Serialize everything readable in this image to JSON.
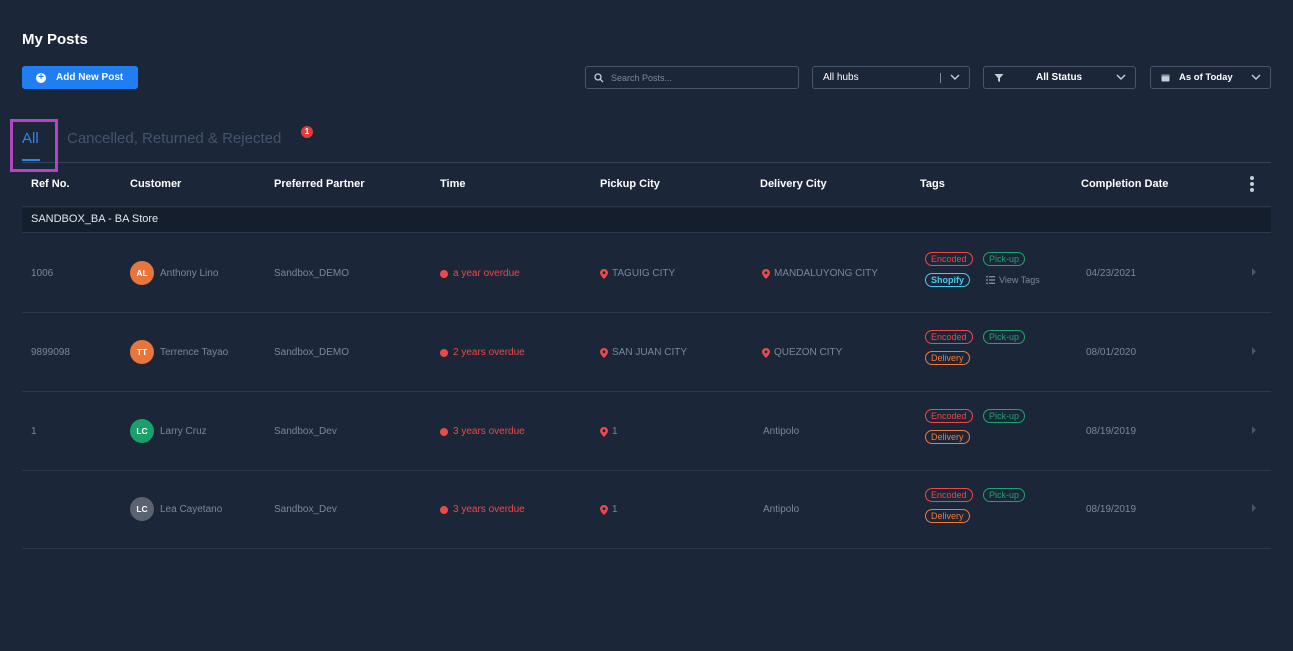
{
  "page": {
    "title": "My Posts"
  },
  "toolbar": {
    "add_label": "Add New Post",
    "search_placeholder": "Search Posts...",
    "hubs_value": "All hubs",
    "status_value": "All Status",
    "date_value": "As of Today"
  },
  "tabs": [
    {
      "label": "All",
      "active": true
    },
    {
      "label": "Cancelled, Returned & Rejected",
      "badge": "1"
    }
  ],
  "table": {
    "headers": [
      "Ref No.",
      "Customer",
      "Preferred Partner",
      "Time",
      "Pickup City",
      "Delivery City",
      "Tags",
      "Completion Date"
    ],
    "group": "SANDBOX_BA - BA Store",
    "rows": [
      {
        "ref": "1006",
        "initials": "AL",
        "avatar_color": "#e8763c",
        "customer": "Anthony Lino",
        "partner": "Sandbox_DEMO",
        "time": "a year overdue",
        "pickup": "TAGUIG CITY",
        "delivery": "MANDALUYONG CITY",
        "tags": [
          "Encoded",
          "Pick-up",
          "Shopify"
        ],
        "view_tags": "View Tags",
        "date": "04/23/2021"
      },
      {
        "ref": "9899098",
        "initials": "TT",
        "avatar_color": "#e8763c",
        "customer": "Terrence Tayao",
        "partner": "Sandbox_DEMO",
        "time": "2 years overdue",
        "pickup": "SAN JUAN CITY",
        "delivery": "QUEZON CITY",
        "tags": [
          "Encoded",
          "Pick-up",
          "Delivery"
        ],
        "date": "08/01/2020"
      },
      {
        "ref": "1",
        "initials": "LC",
        "avatar_color": "#1aa06a",
        "customer": "Larry Cruz",
        "partner": "Sandbox_Dev",
        "time": "3 years overdue",
        "pickup": "1",
        "delivery": "Antipolo",
        "tags": [
          "Encoded",
          "Pick-up",
          "Delivery"
        ],
        "date": "08/19/2019"
      },
      {
        "ref": "",
        "initials": "LC",
        "avatar_color": "#5b6270",
        "customer": "Lea Cayetano",
        "partner": "Sandbox_Dev",
        "time": "3 years overdue",
        "pickup": "1",
        "delivery": "Antipolo",
        "tags": [
          "Encoded",
          "Pick-up",
          "Delivery"
        ],
        "date": "08/19/2019"
      }
    ]
  },
  "colors": {
    "background": "#1b2639",
    "accent": "#1e7ef2",
    "overdue": "#ea4a4a",
    "highlight": "#b445c2"
  }
}
